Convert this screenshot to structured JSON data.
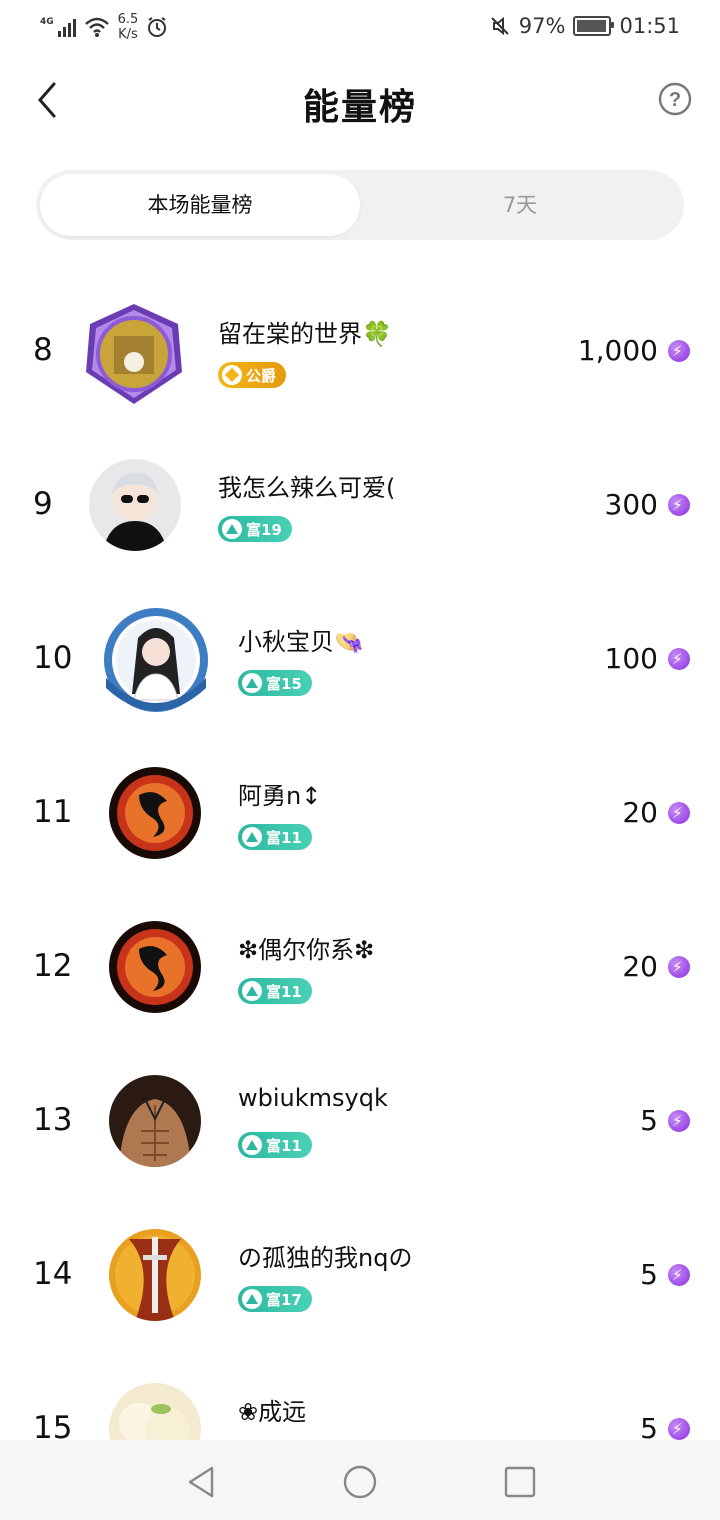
{
  "status_bar": {
    "network": "4G",
    "speed_value": "6.5",
    "speed_unit": "K/s",
    "battery": "97%",
    "battery_level": 0.97,
    "time": "01:51",
    "icons": [
      "signal-icon",
      "wifi-icon",
      "alarm-icon",
      "mute-icon",
      "battery-icon"
    ]
  },
  "header": {
    "title": "能量榜"
  },
  "tabs": [
    {
      "label": "本场能量榜",
      "active": true
    },
    {
      "label": "7天",
      "active": false
    }
  ],
  "rankings": [
    {
      "rank": "8",
      "name": "留在棠的世界🍀",
      "badge_type": "noble",
      "badge_label": "公爵",
      "value": "1,000"
    },
    {
      "rank": "9",
      "name": "我怎么辣么可爱(",
      "badge_type": "wealth",
      "badge_label": "富19",
      "value": "300"
    },
    {
      "rank": "10",
      "name": "小秋宝贝👒",
      "badge_type": "wealth",
      "badge_label": "富15",
      "value": "100"
    },
    {
      "rank": "11",
      "name": "阿勇n↕",
      "badge_type": "wealth",
      "badge_label": "富11",
      "value": "20"
    },
    {
      "rank": "12",
      "name": "❇偶尔你系❇",
      "badge_type": "wealth",
      "badge_label": "富11",
      "value": "20"
    },
    {
      "rank": "13",
      "name": "wbiukmsyqk",
      "badge_type": "wealth",
      "badge_label": "富11",
      "value": "5"
    },
    {
      "rank": "14",
      "name": "の孤独的我nqの",
      "badge_type": "wealth",
      "badge_label": "富17",
      "value": "5"
    },
    {
      "rank": "15",
      "name": "❀成远",
      "badge_type": "wealth",
      "badge_label": "",
      "value": "5"
    }
  ],
  "colors": {
    "wealth_badge": "#2cb8a0",
    "noble_badge": "#f2b51b",
    "energy_icon": "#8a2ee0",
    "tab_track": "#f1f1f1",
    "inactive_tab_text": "#999999"
  }
}
